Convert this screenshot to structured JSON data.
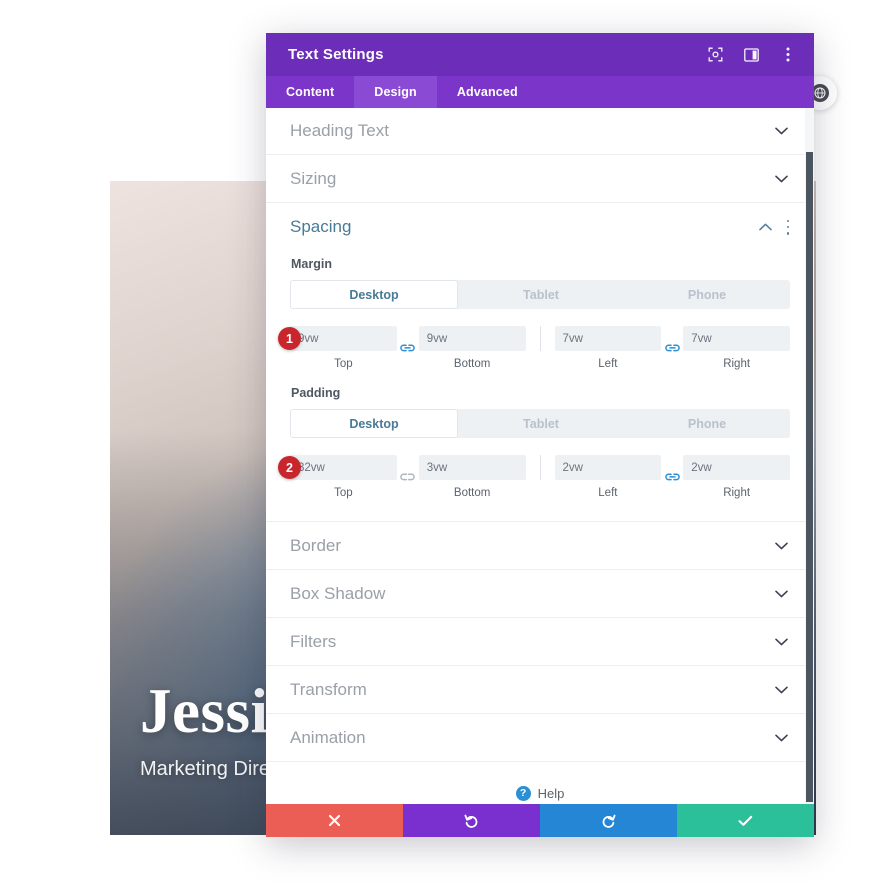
{
  "background": {
    "hero_name": "Jessica",
    "hero_role": "Marketing Director",
    "float_button_icon": "globe-icon"
  },
  "modal": {
    "title": "Text Settings",
    "header_icons": [
      {
        "name": "focus-target-icon"
      },
      {
        "name": "layout-panel-icon"
      },
      {
        "name": "kebab-menu-icon"
      }
    ],
    "tabs": [
      {
        "label": "Content",
        "active": false
      },
      {
        "label": "Design",
        "active": true
      },
      {
        "label": "Advanced",
        "active": false
      }
    ],
    "sections_above": [
      {
        "label": "Heading Text",
        "state": "collapsed",
        "icon": "chevron-down-icon"
      },
      {
        "label": "Sizing",
        "state": "collapsed",
        "icon": "chevron-down-icon"
      }
    ],
    "spacing": {
      "label": "Spacing",
      "state": "expanded",
      "collapse_icon": "chevron-up-icon",
      "menu_icon": "kebab-menu-icon",
      "groups": [
        {
          "badge": "1",
          "label": "Margin",
          "device_tabs": [
            {
              "label": "Desktop",
              "active": true
            },
            {
              "label": "Tablet",
              "active": false
            },
            {
              "label": "Phone",
              "active": false
            }
          ],
          "fields": [
            {
              "value": "9vw",
              "caption": "Top"
            },
            {
              "value": "9vw",
              "caption": "Bottom"
            },
            {
              "value": "7vw",
              "caption": "Left"
            },
            {
              "value": "7vw",
              "caption": "Right"
            }
          ],
          "link_left": {
            "name": "link-connected-icon",
            "linked": true
          },
          "link_right": {
            "name": "link-connected-icon",
            "linked": true
          }
        },
        {
          "badge": "2",
          "label": "Padding",
          "device_tabs": [
            {
              "label": "Desktop",
              "active": true
            },
            {
              "label": "Tablet",
              "active": false
            },
            {
              "label": "Phone",
              "active": false
            }
          ],
          "fields": [
            {
              "value": "32vw",
              "caption": "Top"
            },
            {
              "value": "3vw",
              "caption": "Bottom"
            },
            {
              "value": "2vw",
              "caption": "Left"
            },
            {
              "value": "2vw",
              "caption": "Right"
            }
          ],
          "link_left": {
            "name": "link-broken-icon",
            "linked": false
          },
          "link_right": {
            "name": "link-connected-icon",
            "linked": true
          }
        }
      ]
    },
    "sections_below": [
      {
        "label": "Border",
        "state": "collapsed",
        "icon": "chevron-down-icon"
      },
      {
        "label": "Box Shadow",
        "state": "collapsed",
        "icon": "chevron-down-icon"
      },
      {
        "label": "Filters",
        "state": "collapsed",
        "icon": "chevron-down-icon"
      },
      {
        "label": "Transform",
        "state": "collapsed",
        "icon": "chevron-down-icon"
      },
      {
        "label": "Animation",
        "state": "collapsed",
        "icon": "chevron-down-icon"
      }
    ],
    "help": {
      "label": "Help",
      "icon": "help-circle-icon"
    },
    "footer_buttons": [
      {
        "name": "cancel-button",
        "icon": "close-icon",
        "color": "#eb5e55"
      },
      {
        "name": "undo-button",
        "icon": "undo-icon",
        "color": "#7a2fcf"
      },
      {
        "name": "redo-button",
        "icon": "redo-icon",
        "color": "#2586d6"
      },
      {
        "name": "save-button",
        "icon": "check-icon",
        "color": "#2bbf9a"
      }
    ]
  },
  "colors": {
    "header_purple": "#6c2eb9",
    "tabs_purple": "#7b35c9",
    "tab_active_purple": "#8b4ad4",
    "accent_blue": "#4a7a96",
    "badge_red": "#c9252d"
  }
}
